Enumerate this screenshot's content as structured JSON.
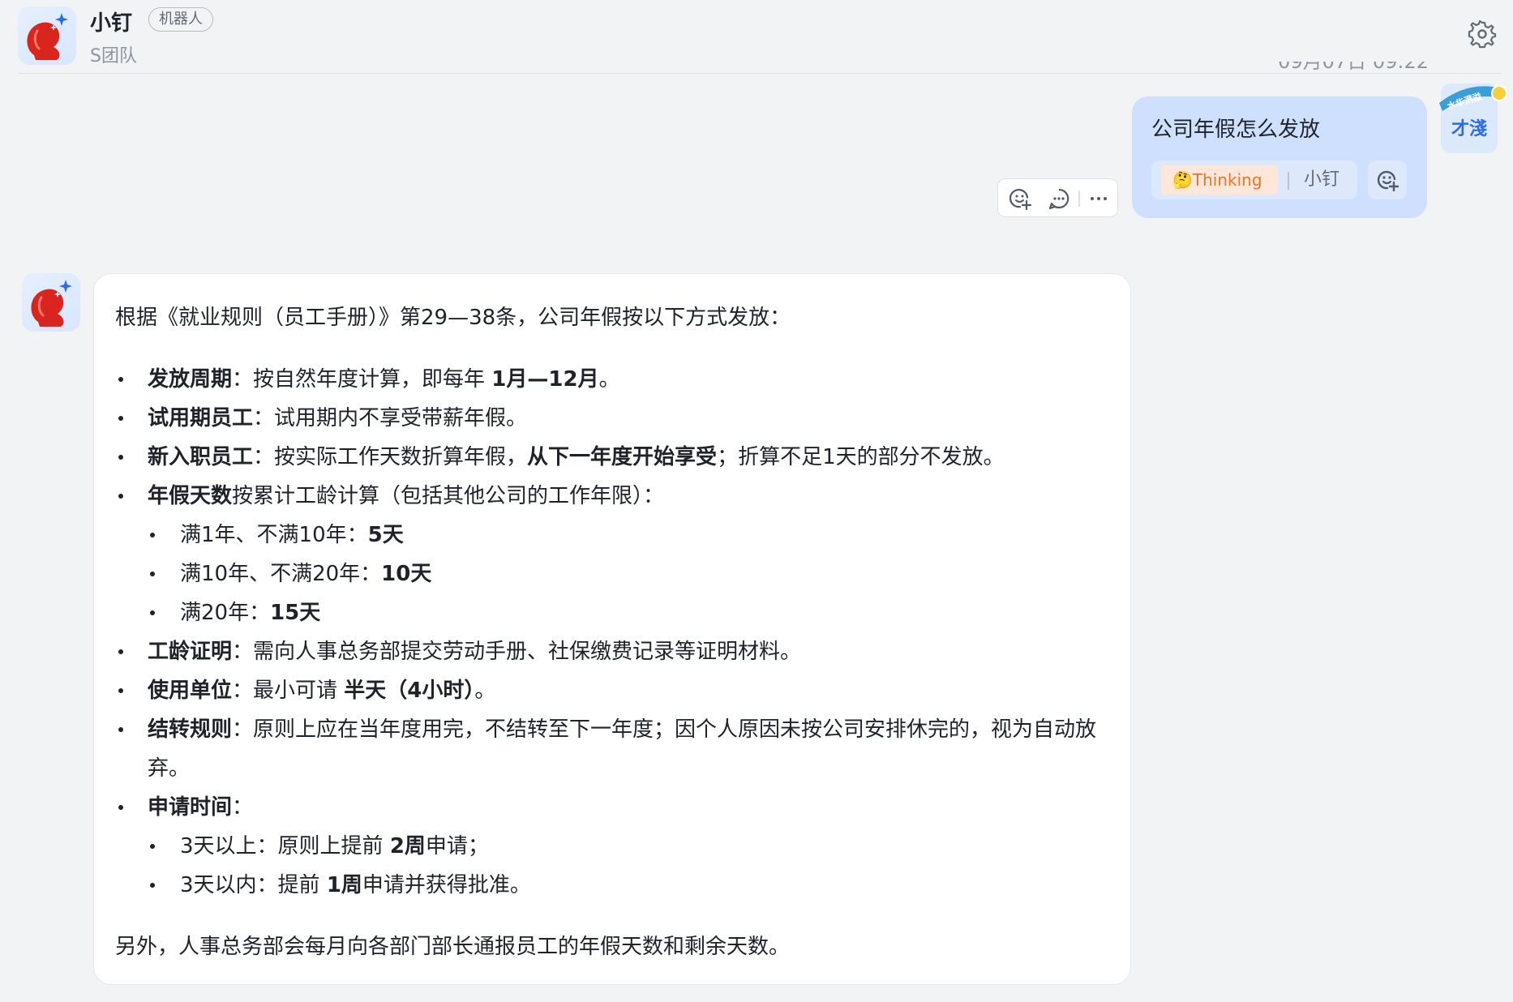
{
  "header": {
    "bot_name": "小钉",
    "bot_badge": "机器人",
    "team_name": "S团队"
  },
  "timestamp": "09月07日 09:22",
  "user_message": {
    "text": "公司年假怎么发放",
    "thinking_label": "🤔Thinking",
    "mention_label": "小钉"
  },
  "user": {
    "avatar_name": "才淺",
    "avatar_badge": "水华满溢"
  },
  "answer": {
    "intro": "根据《就业规则（员工手册）》第29—38条，公司年假按以下方式发放：",
    "items": [
      {
        "title": "发放周期",
        "sep": "：",
        "text": "按自然年度计算，即每年 ",
        "bold": "1月—12月",
        "after": "。"
      },
      {
        "title": "试用期员工",
        "sep": "：",
        "text": "试用期内不享受带薪年假。"
      },
      {
        "title": "新入职员工",
        "sep": "：",
        "text": "按实际工作天数折算年假，",
        "bold": "从下一年度开始享受",
        "after": "；折算不足1天的部分不发放。"
      },
      {
        "title": "年假天数",
        "text": "按累计工龄计算（包括其他公司的工作年限）：",
        "sub": [
          {
            "text": "满1年、不满10年：",
            "bold": "5天"
          },
          {
            "text": "满10年、不满20年：",
            "bold": "10天"
          },
          {
            "text": "满20年：",
            "bold": "15天"
          }
        ]
      },
      {
        "title": "工龄证明",
        "sep": "：",
        "text": "需向人事总务部提交劳动手册、社保缴费记录等证明材料。"
      },
      {
        "title": "使用单位",
        "sep": "：",
        "text": "最小可请 ",
        "bold": "半天（4小时）",
        "after": "。"
      },
      {
        "title": "结转规则",
        "sep": "：",
        "text": "原则上应在当年度用完，不结转至下一年度；因个人原因未按公司安排休完的，视为自动放弃。"
      },
      {
        "title": "申请时间",
        "sep": "：",
        "sub": [
          {
            "text": "3天以上：原则上提前 ",
            "bold": "2周",
            "after": "申请；"
          },
          {
            "text": "3天以内：提前 ",
            "bold": "1周",
            "after": "申请并获得批准。"
          }
        ]
      }
    ],
    "footer": "另外，人事总务部会每月向各部门部长通报员工的年假天数和剩余天数。"
  },
  "icons": {
    "settings": "gear-icon",
    "add_reaction": "emoji-add-icon",
    "reply": "comment-icon",
    "more": "more-icon"
  },
  "colors": {
    "user_bubble": "#cfe0ff",
    "accent_blue": "#2b6de8",
    "thinking_orange": "#e8762c",
    "bot_red": "#d9251d"
  }
}
